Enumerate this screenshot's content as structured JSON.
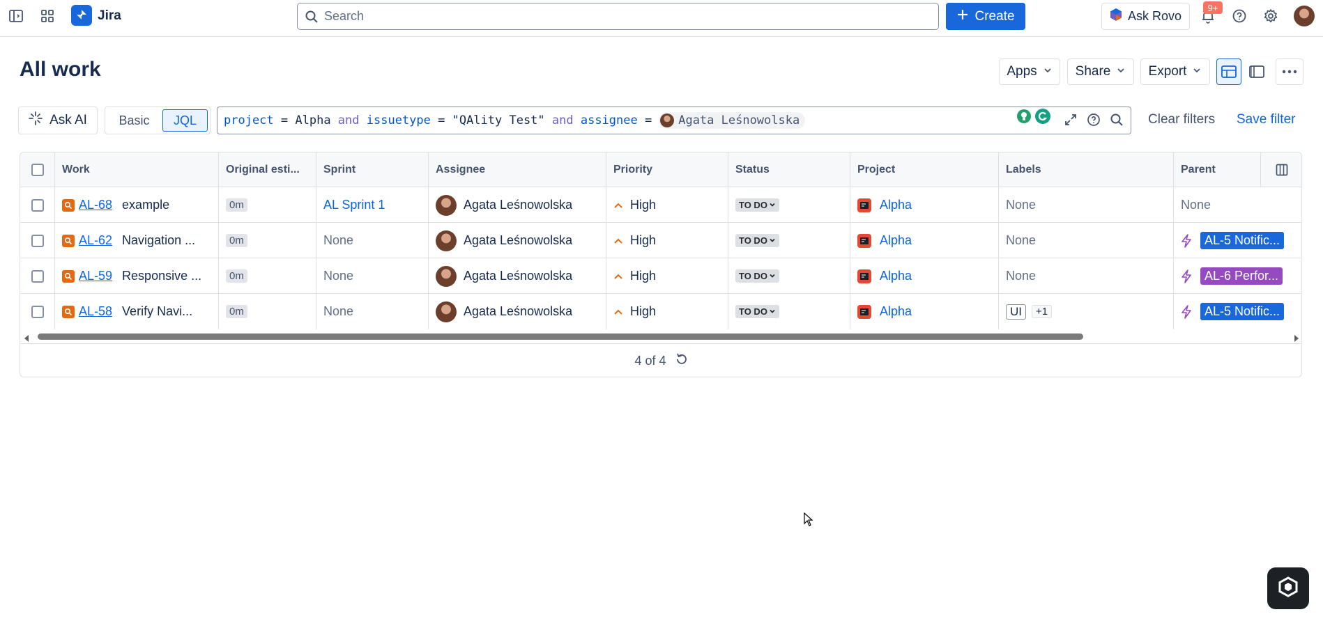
{
  "topnav": {
    "app_name": "Jira",
    "search_placeholder": "Search",
    "create_label": "Create",
    "ask_rovo_label": "Ask Rovo",
    "notification_badge": "9+"
  },
  "page": {
    "title": "All work",
    "buttons": {
      "apps": "Apps",
      "share": "Share",
      "export": "Export"
    }
  },
  "filter": {
    "ask_ai_label": "Ask AI",
    "mode_basic": "Basic",
    "mode_jql": "JQL",
    "jql": {
      "t1": "project",
      "t2": " = ",
      "t3": "Alpha",
      "t4": " and ",
      "t5": "issuetype",
      "t6": " = ",
      "t7": "\"QAlity Test\"",
      "t8": " and ",
      "t9": "assignee",
      "t10": " =",
      "user": "Agata Leśnowolska"
    },
    "clear_label": "Clear filters",
    "save_label": "Save filter"
  },
  "table": {
    "columns": {
      "work": "Work",
      "estimate": "Original esti...",
      "sprint": "Sprint",
      "assignee": "Assignee",
      "priority": "Priority",
      "status": "Status",
      "project": "Project",
      "labels": "Labels",
      "parent": "Parent"
    },
    "rows": [
      {
        "key": "AL-68",
        "summary": "example",
        "estimate": "0m",
        "sprint": "AL Sprint 1",
        "assignee": "Agata Leśnowolska",
        "priority": "High",
        "status": "TO DO",
        "project": "Alpha",
        "labels": "None",
        "parent": "None"
      },
      {
        "key": "AL-62",
        "summary": "Navigation ...",
        "estimate": "0m",
        "sprint": "None",
        "assignee": "Agata Leśnowolska",
        "priority": "High",
        "status": "TO DO",
        "project": "Alpha",
        "labels": "None",
        "parent": "AL-5 Notific..."
      },
      {
        "key": "AL-59",
        "summary": "Responsive ...",
        "estimate": "0m",
        "sprint": "None",
        "assignee": "Agata Leśnowolska",
        "priority": "High",
        "status": "TO DO",
        "project": "Alpha",
        "labels": "None",
        "parent": "AL-6 Perfor..."
      },
      {
        "key": "AL-58",
        "summary": "Verify Navi...",
        "estimate": "0m",
        "sprint": "None",
        "assignee": "Agata Leśnowolska",
        "priority": "High",
        "status": "TO DO",
        "project": "Alpha",
        "label_tag": "UI",
        "label_more": "+1",
        "parent": "AL-5 Notific..."
      }
    ],
    "footer_count": "4 of 4"
  },
  "colors": {
    "brand": "#1868db",
    "link": "#0c66e4",
    "issue_icon": "#e56910",
    "project_icon": "#e34935",
    "parent_blue": "#1868db",
    "parent_purple": "#964ac0"
  }
}
